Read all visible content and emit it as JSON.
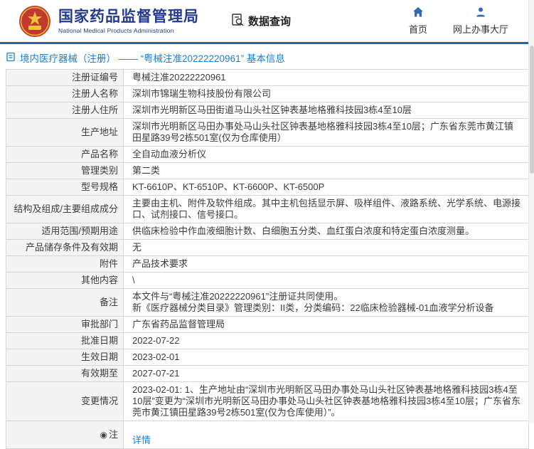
{
  "header": {
    "org_cn": "国家药品监督管理局",
    "org_en": "National Medical Products Administration",
    "data_query": "数据查询",
    "home": "首页",
    "online_hall": "网上办事大厅"
  },
  "page_title": "境内医疗器械（注册） ——  “粤械注准20222220961” 基本信息",
  "rows": [
    {
      "label": "注册证编号",
      "value": "粤械注准20222220961"
    },
    {
      "label": "注册人名称",
      "value": "深圳市锦瑞生物科技股份有限公司"
    },
    {
      "label": "注册人住所",
      "value": "深圳市光明新区马田街道马山头社区钟表基地格雅科技园3栋4至10层"
    },
    {
      "label": "生产地址",
      "value": "深圳市光明新区马田办事处马山头社区钟表基地格雅科技园3栋4至10层；广东省东莞市黄江镇田星路39号2栋501室(仅为仓库使用）"
    },
    {
      "label": "产品名称",
      "value": "全自动血液分析仪"
    },
    {
      "label": "管理类别",
      "value": "第二类"
    },
    {
      "label": "型号规格",
      "value": "KT-6610P、KT-6510P、KT-6600P、KT-6500P"
    },
    {
      "label": "结构及组成/主要组成成分",
      "value": "主要由主机、附件及软件组成。其中主机包括显示屏、吸样组件、液路系统、光学系统、电源接口、试剂接口、信号接口。"
    },
    {
      "label": "适用范围/预期用途",
      "value": "供临床检验中作血液细胞计数、白细胞五分类、血红蛋白浓度和特定蛋白浓度测量。"
    },
    {
      "label": "产品储存条件及有效期",
      "value": "无"
    },
    {
      "label": "附件",
      "value": "产品技术要求"
    },
    {
      "label": "其他内容",
      "value": "\\"
    },
    {
      "label": "备注",
      "value": "本文件与“粤械注准20222220961”注册证共同使用。\n新《医疗器械分类目录》管理类别：II类，分类编码：22临床检验器械-01血液学分析设备"
    },
    {
      "label": "审批部门",
      "value": "广东省药品监督管理局"
    },
    {
      "label": "批准日期",
      "value": "2022-07-22"
    },
    {
      "label": "生效日期",
      "value": "2023-02-01"
    },
    {
      "label": "有效期至",
      "value": "2027-07-21"
    },
    {
      "label": "变更情况",
      "value": "2023-02-01: 1、生产地址由“深圳市光明新区马田办事处马山头社区钟表基地格雅科技园3栋4至10层”变更为“深圳市光明新区马田办事处马山头社区钟表基地格雅科技园3栋4至10层；广东省东莞市黄江镇田星路39号2栋501室(仅为仓库使用）”。"
    },
    {
      "label": "注",
      "value": "详情"
    }
  ]
}
